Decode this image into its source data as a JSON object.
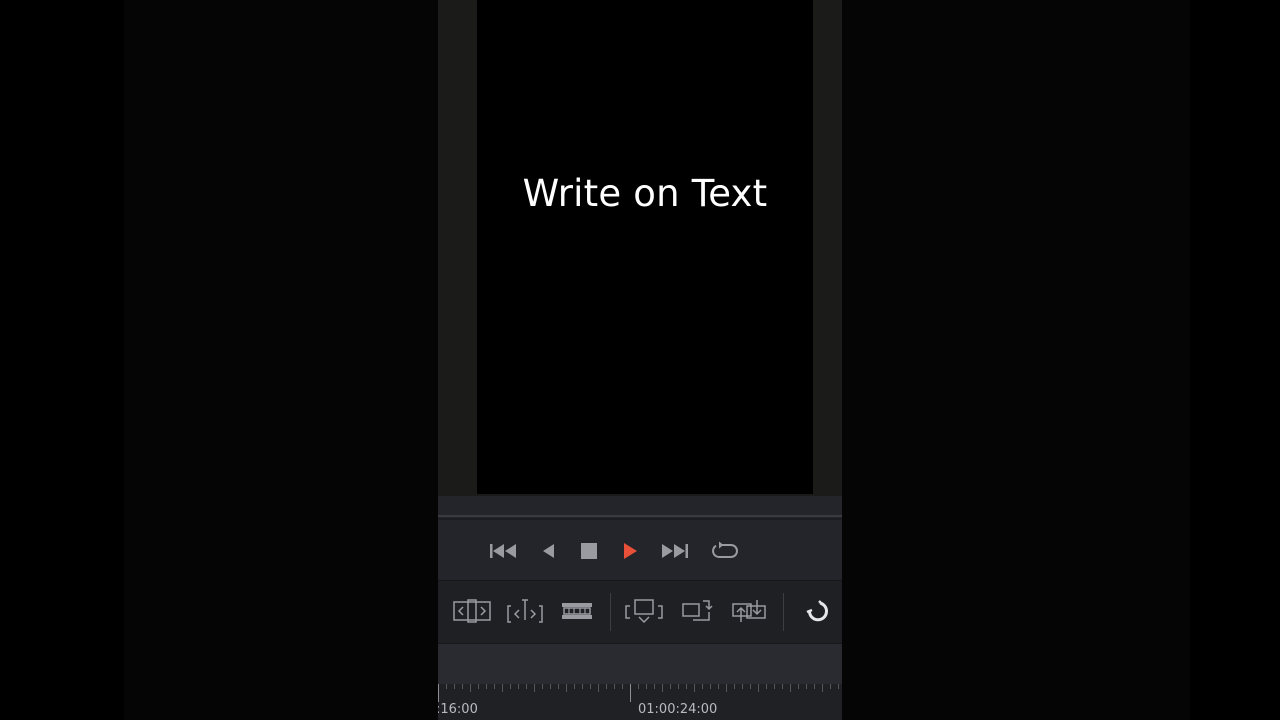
{
  "viewer": {
    "title_text": "Write on Text"
  },
  "colors": {
    "play_accent": "#e8503a",
    "icon_gray": "#9a9ba1",
    "icon_white": "#e6e6e8",
    "panel": "#24252a"
  },
  "transport": {
    "buttons": [
      {
        "name": "go-to-start",
        "icon": "skip-to-start-icon"
      },
      {
        "name": "play-reverse",
        "icon": "play-reverse-icon"
      },
      {
        "name": "stop",
        "icon": "stop-icon"
      },
      {
        "name": "play-forward",
        "icon": "play-icon"
      },
      {
        "name": "go-to-end",
        "icon": "skip-to-end-icon"
      },
      {
        "name": "loop",
        "icon": "loop-icon"
      }
    ]
  },
  "edit_toolbar": {
    "buttons": [
      {
        "name": "smart-insert",
        "icon": "smart-insert-icon"
      },
      {
        "name": "append-at-end",
        "icon": "append-icon"
      },
      {
        "name": "ripple-overwrite",
        "icon": "ripple-overwrite-icon"
      },
      {
        "name": "close-up",
        "icon": "close-up-icon"
      },
      {
        "name": "place-on-top",
        "icon": "place-on-top-icon"
      },
      {
        "name": "source-overwrite",
        "icon": "source-overwrite-icon"
      },
      {
        "name": "snapping",
        "icon": "magnet-icon"
      }
    ]
  },
  "timeline": {
    "timecodes": [
      ":16:00",
      "01:00:24:00"
    ]
  }
}
